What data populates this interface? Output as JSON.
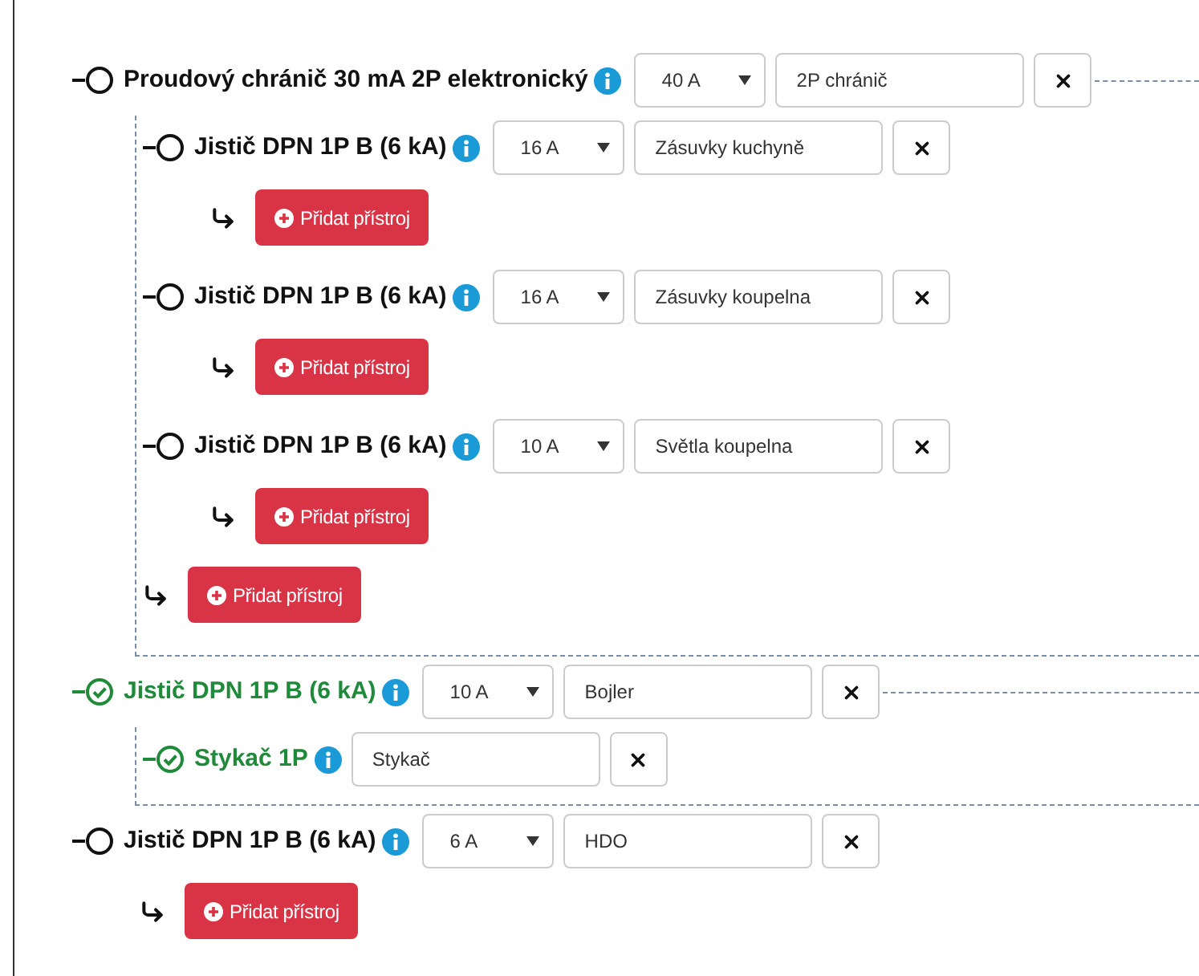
{
  "nodes": [
    {
      "name": "Proudový chránič 30 mA 2P elektronický",
      "checked": false,
      "rating": "40 A",
      "label": "2P chránič",
      "add_button": "Přidat přístroj",
      "children": [
        {
          "name": "Jistič DPN 1P B (6 kA)",
          "checked": false,
          "rating": "16 A",
          "label": "Zásuvky kuchyně",
          "add_button": "Přidat přístroj"
        },
        {
          "name": "Jistič DPN 1P B (6 kA)",
          "checked": false,
          "rating": "16 A",
          "label": "Zásuvky koupelna",
          "add_button": "Přidat přístroj"
        },
        {
          "name": "Jistič DPN 1P B (6 kA)",
          "checked": false,
          "rating": "10 A",
          "label": "Světla koupelna",
          "add_button": "Přidat přístroj"
        }
      ]
    },
    {
      "name": "Jistič DPN 1P B (6 kA)",
      "checked": true,
      "rating": "10 A",
      "label": "Bojler",
      "children": [
        {
          "name": "Stykač 1P",
          "checked": true,
          "label": "Stykač"
        }
      ]
    },
    {
      "name": "Jistič DPN 1P B (6 kA)",
      "checked": false,
      "rating": "6 A",
      "label": "HDO",
      "add_button": "Přidat přístroj"
    }
  ]
}
